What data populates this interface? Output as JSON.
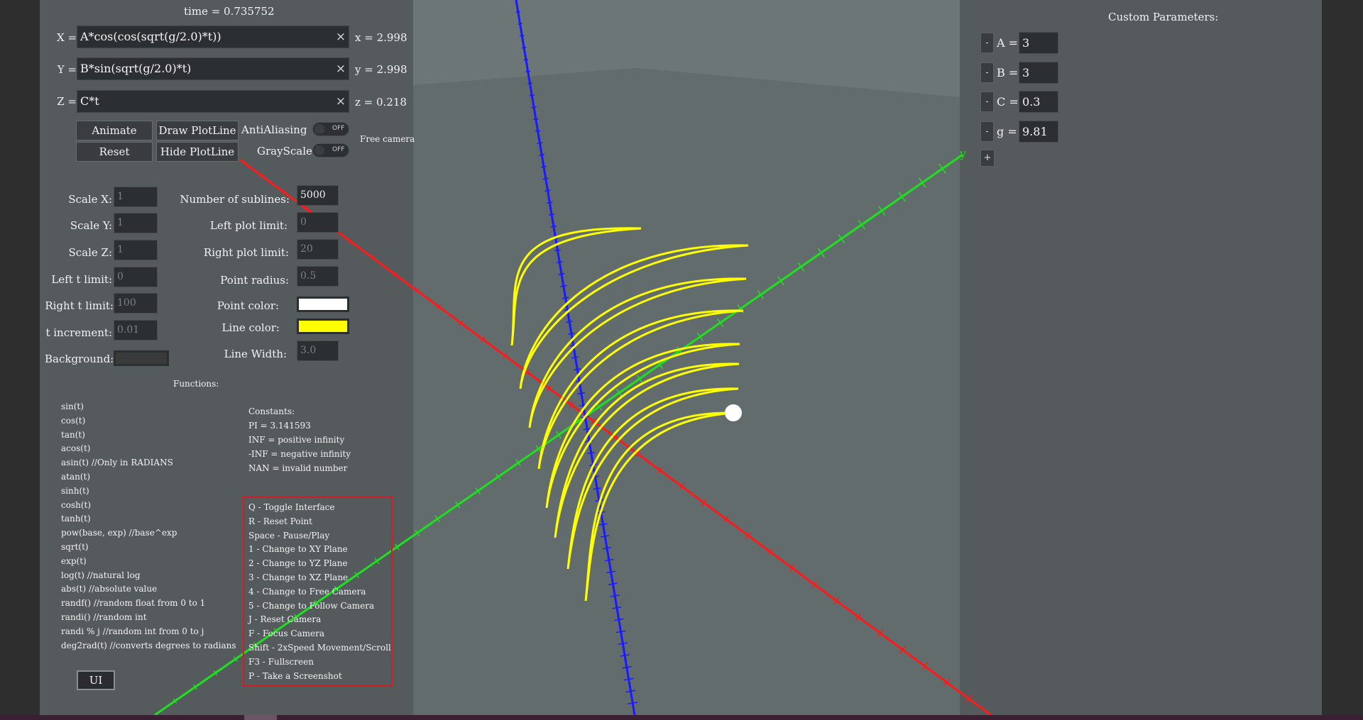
{
  "header": {
    "time_readout": "time = 0.735752"
  },
  "equations": [
    {
      "label": "X =",
      "expression": "A*cos(cos(sqrt(g/2.0)*t))",
      "readout": "x = 2.998"
    },
    {
      "label": "Y =",
      "expression": "B*sin(sqrt(g/2.0)*t)",
      "readout": "y = 2.998"
    },
    {
      "label": "Z =",
      "expression": "C*t",
      "readout": "z = 0.218"
    }
  ],
  "clear_glyph": "×",
  "buttons": {
    "animate": "Animate",
    "reset": "Reset",
    "draw_plotline": "Draw PlotLine",
    "hide_plotline": "Hide PlotLine",
    "ui": "UI"
  },
  "toggles": {
    "antialiasing": {
      "label": "AntiAliasing",
      "state": "OFF"
    },
    "grayscale": {
      "label": "GrayScale",
      "state": "OFF"
    }
  },
  "camera_mode": "Free camera",
  "settings_left": [
    {
      "label": "Scale X:",
      "value": "1"
    },
    {
      "label": "Scale Y:",
      "value": "1"
    },
    {
      "label": "Scale Z:",
      "value": "1"
    },
    {
      "label": "Left t limit:",
      "value": "0"
    },
    {
      "label": "Right t limit:",
      "value": "100"
    },
    {
      "label": "t  increment:",
      "value": "0.01"
    }
  ],
  "background": {
    "label": "Background:",
    "color": "#3a3a3a"
  },
  "settings_right": [
    {
      "label": "Number of sublines:",
      "value": "5000"
    },
    {
      "label": "Left plot limit:",
      "value": "0"
    },
    {
      "label": "Right plot limit:",
      "value": "20"
    },
    {
      "label": "Point radius:",
      "value": "0.5"
    }
  ],
  "point_color": {
    "label": "Point color:",
    "color": "#ffffff"
  },
  "line_color": {
    "label": "Line color:",
    "color": "#ffff00"
  },
  "line_width": {
    "label": "Line Width:",
    "value": "3.0"
  },
  "functions": {
    "title": "Functions:",
    "items": [
      "sin(t)",
      "cos(t)",
      "tan(t)",
      "acos(t)",
      "asin(t)     //Only in RADIANS",
      "atan(t)",
      "sinh(t)",
      "cosh(t)",
      "tanh(t)",
      "pow(base, exp)   //base^exp",
      "sqrt(t)",
      "exp(t)",
      "log(t)   //natural log",
      "abs(t)   //absolute value",
      "randf()   //random float from 0 to 1",
      "randi()   //random int",
      "randi % j   //random int from 0 to j",
      "deg2rad(t)   //converts degrees to radians"
    ]
  },
  "constants": {
    "title": "Constants:",
    "items": [
      "PI = 3.141593",
      "INF = positive infinity",
      "-INF = negative infinity",
      "NAN = invalid number"
    ]
  },
  "shortcuts": [
    "Q - Toggle Interface",
    "R - Reset Point",
    "Space - Pause/Play",
    "1 - Change to XY Plane",
    "2 - Change to YZ Plane",
    "3 - Change to XZ Plane",
    "4 - Change to Free Camera",
    "5 - Change to Follow Camera",
    "J - Reset Camera",
    "F - Focus Camera",
    "Shift - 2xSpeed Movement/Scroll",
    "F3 - Fullscreen",
    "P - Take a Screenshot"
  ],
  "custom_parameters": {
    "title": "Custom Parameters:",
    "minus_label": "-",
    "plus_label": "+",
    "items": [
      {
        "name": "A =",
        "value": "3"
      },
      {
        "name": "B =",
        "value": "3"
      },
      {
        "name": "C =",
        "value": "0.3"
      },
      {
        "name": "g =",
        "value": "9.81"
      }
    ]
  },
  "axis_labels": {
    "y": "y"
  },
  "colors": {
    "viewport": "#5a6262",
    "x_axis": "#ff1a1a",
    "y_axis": "#1fe01f",
    "z_axis": "#1a1aff",
    "curve": "#ffff00",
    "point": "#ffffff",
    "shortcut_box_border": "#d21e1e"
  }
}
